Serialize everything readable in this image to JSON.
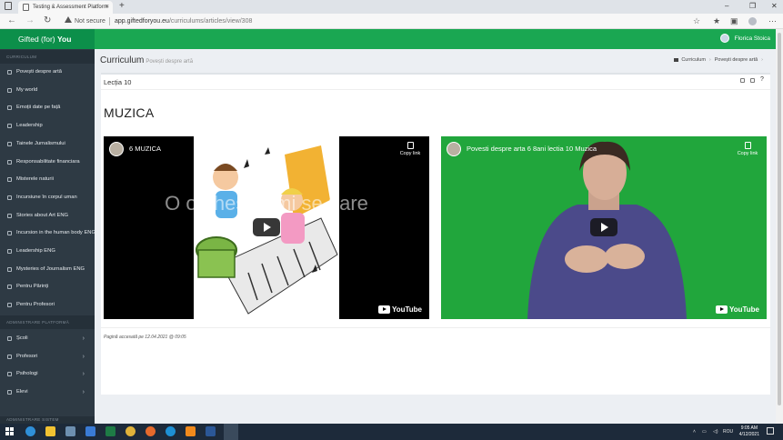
{
  "browser": {
    "tab_title": "Testing & Assessment Platform",
    "new_tab_glyph": "+",
    "security_label": "Not secure",
    "url_host": "app.giftedforyou.eu",
    "url_path": "/curriculums/articles/view/308"
  },
  "app": {
    "brand_prefix": "Gifted (for)",
    "brand_strong": "You",
    "user_name": "Florica Stoica",
    "colors": {
      "brand": "#0c8f4a",
      "topbar": "#1aa752",
      "sidebar": "#2e3a44"
    }
  },
  "sidebar": {
    "section_curriculum": "CURRICULUM",
    "curriculum_items": [
      {
        "label": "Povești despre artă",
        "icon": "book-icon"
      },
      {
        "label": "My world",
        "icon": "book-icon"
      },
      {
        "label": "Emoții date pe față",
        "icon": "book-icon"
      },
      {
        "label": "Leadership",
        "icon": "book-icon"
      },
      {
        "label": "Tainele Jurnalismului",
        "icon": "book-icon"
      },
      {
        "label": "Responsabilitate financiara",
        "icon": "book-icon"
      },
      {
        "label": "Misterele naturii",
        "icon": "book-icon"
      },
      {
        "label": "Incursiune în corpul uman",
        "icon": "book-icon"
      },
      {
        "label": "Stories about Art ENG",
        "icon": "book-icon"
      },
      {
        "label": "Incursion in the human body ENG",
        "icon": "book-icon"
      },
      {
        "label": "Leadership ENG",
        "icon": "book-icon"
      },
      {
        "label": "Mysteries of Journalism ENG",
        "icon": "book-icon"
      },
      {
        "label": "Pentru Părinți",
        "icon": "book-icon"
      },
      {
        "label": "Pentru Profesori",
        "icon": "book-icon"
      }
    ],
    "section_admin": "ADMINISTRARE PLATFORMĂ",
    "admin_items": [
      {
        "label": "Școli",
        "icon": "building-icon"
      },
      {
        "label": "Profesori",
        "icon": "graduation-cap-icon"
      },
      {
        "label": "Psihologi",
        "icon": "users-icon"
      },
      {
        "label": "Elevi",
        "icon": "user-icon"
      }
    ],
    "section_system": "ADMINISTRARE SISTEM"
  },
  "page": {
    "title": "Curriculum",
    "subtitle": "Povești despre artă",
    "breadcrumb": [
      "Curriculum",
      "Povești despre artă"
    ]
  },
  "lesson": {
    "box_title": "Lecția 10",
    "heading": "MUZICA",
    "accessed_text": "Pagină accesată pe 12.04.2021 @ 09:05"
  },
  "videos": [
    {
      "title": "6 MUZICA",
      "overlay_text": "O orchestra mi se pare",
      "copy_label": "Copy link",
      "brand": "YouTube"
    },
    {
      "title": "Povesti despre arta 6 8ani lectia 10 Muzica",
      "copy_label": "Copy link",
      "brand": "YouTube"
    }
  ],
  "taskbar": {
    "lang": "ROU",
    "time": "9:05 AM",
    "date": "4/12/2021"
  }
}
